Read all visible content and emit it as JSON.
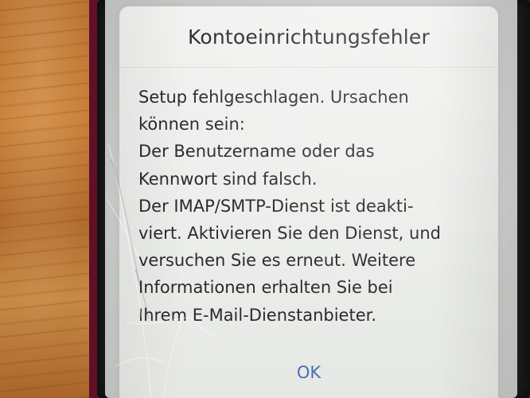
{
  "dialog": {
    "title": "Kontoeinrichtungsfehler",
    "message": "Setup fehlgeschlagen. Ursachen\nkönnen sein:\nDer Benutzername oder das\nKennwort sind falsch.\nDer IMAP/SMTP-Dienst ist deakti-\nviert. Aktivieren Sie den Dienst, und\nversuchen Sie es erneut. Weitere\nInformationen erhalten Sie bei\nIhrem E-Mail-Dienstanbieter.",
    "ok_label": "OK"
  },
  "colors": {
    "accent": "#4a6fb5",
    "dialog_background": "#eceeeb",
    "text": "#2a2a2a",
    "phone_case": "#8a1c3a",
    "desk_wood": "#c98038"
  }
}
